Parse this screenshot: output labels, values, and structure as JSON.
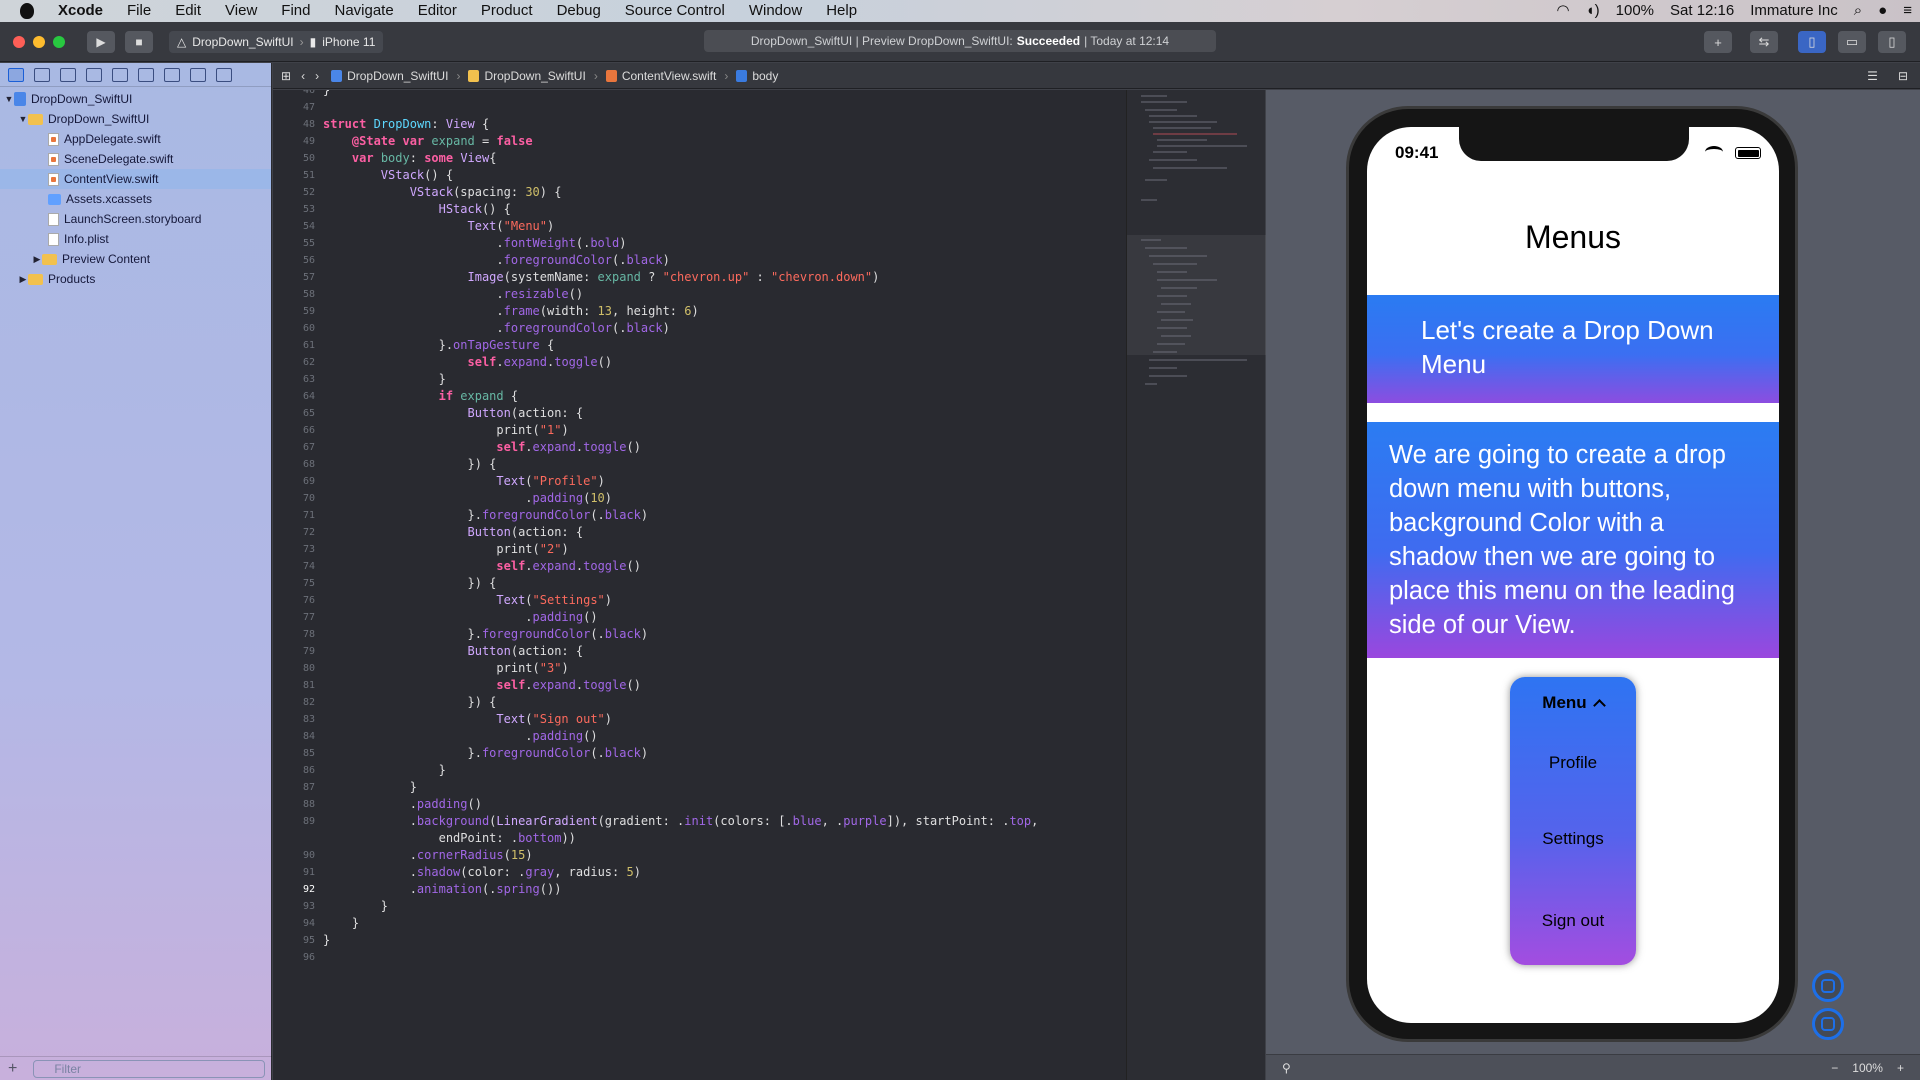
{
  "menubar": {
    "app_name": "Xcode",
    "items": [
      "File",
      "Edit",
      "View",
      "Find",
      "Navigate",
      "Editor",
      "Product",
      "Debug",
      "Source Control",
      "Window",
      "Help"
    ],
    "battery": "100%",
    "clock": "Sat 12:16",
    "user": "Immature Inc"
  },
  "toolbar": {
    "scheme": "DropDown_SwiftUI",
    "device": "iPhone 11",
    "status_prefix": "DropDown_SwiftUI | Preview DropDown_SwiftUI:",
    "status_result": "Succeeded",
    "status_suffix": "| Today at 12:14"
  },
  "navigator": {
    "project": "DropDown_SwiftUI",
    "group": "DropDown_SwiftUI",
    "files": [
      "AppDelegate.swift",
      "SceneDelegate.swift",
      "ContentView.swift",
      "Assets.xcassets",
      "LaunchScreen.storyboard",
      "Info.plist"
    ],
    "preview_content": "Preview Content",
    "products": "Products",
    "filter_placeholder": "Filter"
  },
  "jumpbar": {
    "crumbs": [
      "DropDown_SwiftUI",
      "DropDown_SwiftUI",
      "ContentView.swift",
      "body"
    ]
  },
  "editor": {
    "current_line": 92,
    "lines": [
      {
        "n": "46",
        "code": "}"
      },
      {
        "n": "47",
        "code": ""
      },
      {
        "n": "48",
        "code": "struct DropDown: View {"
      },
      {
        "n": "49",
        "code": "    @State var expand = false"
      },
      {
        "n": "50",
        "code": "    var body: some View{"
      },
      {
        "n": "51",
        "code": "        VStack() {"
      },
      {
        "n": "52",
        "code": "            VStack(spacing: 30) {"
      },
      {
        "n": "53",
        "code": "                HStack() {"
      },
      {
        "n": "54",
        "code": "                    Text(\"Menu\")"
      },
      {
        "n": "55",
        "code": "                        .fontWeight(.bold)"
      },
      {
        "n": "56",
        "code": "                        .foregroundColor(.black)"
      },
      {
        "n": "57",
        "code": "                    Image(systemName: expand ? \"chevron.up\" : \"chevron.down\")"
      },
      {
        "n": "58",
        "code": "                        .resizable()"
      },
      {
        "n": "59",
        "code": "                        .frame(width: 13, height: 6)"
      },
      {
        "n": "60",
        "code": "                        .foregroundColor(.black)"
      },
      {
        "n": "61",
        "code": "                }.onTapGesture {"
      },
      {
        "n": "62",
        "code": "                    self.expand.toggle()"
      },
      {
        "n": "63",
        "code": "                }"
      },
      {
        "n": "64",
        "code": "                if expand {"
      },
      {
        "n": "65",
        "code": "                    Button(action: {"
      },
      {
        "n": "66",
        "code": "                        print(\"1\")"
      },
      {
        "n": "67",
        "code": "                        self.expand.toggle()"
      },
      {
        "n": "68",
        "code": "                    }) {"
      },
      {
        "n": "69",
        "code": "                        Text(\"Profile\")"
      },
      {
        "n": "70",
        "code": "                            .padding(10)"
      },
      {
        "n": "71",
        "code": "                    }.foregroundColor(.black)"
      },
      {
        "n": "72",
        "code": "                    Button(action: {"
      },
      {
        "n": "73",
        "code": "                        print(\"2\")"
      },
      {
        "n": "74",
        "code": "                        self.expand.toggle()"
      },
      {
        "n": "75",
        "code": "                    }) {"
      },
      {
        "n": "76",
        "code": "                        Text(\"Settings\")"
      },
      {
        "n": "77",
        "code": "                            .padding()"
      },
      {
        "n": "78",
        "code": "                    }.foregroundColor(.black)"
      },
      {
        "n": "79",
        "code": "                    Button(action: {"
      },
      {
        "n": "80",
        "code": "                        print(\"3\")"
      },
      {
        "n": "81",
        "code": "                        self.expand.toggle()"
      },
      {
        "n": "82",
        "code": "                    }) {"
      },
      {
        "n": "83",
        "code": "                        Text(\"Sign out\")"
      },
      {
        "n": "84",
        "code": "                            .padding()"
      },
      {
        "n": "85",
        "code": "                    }.foregroundColor(.black)"
      },
      {
        "n": "86",
        "code": "                }"
      },
      {
        "n": "87",
        "code": "            }"
      },
      {
        "n": "88",
        "code": "            .padding()"
      },
      {
        "n": "89",
        "code": "            .background(LinearGradient(gradient: .init(colors: [.blue, .purple]), startPoint: .top,"
      },
      {
        "n": "",
        "code": "                endPoint: .bottom))"
      },
      {
        "n": "90",
        "code": "            .cornerRadius(15)"
      },
      {
        "n": "91",
        "code": "            .shadow(color: .gray, radius: 5)"
      },
      {
        "n": "92",
        "code": "            .animation(.spring())"
      },
      {
        "n": "93",
        "code": "        }"
      },
      {
        "n": "94",
        "code": "    }"
      },
      {
        "n": "95",
        "code": "}"
      },
      {
        "n": "96",
        "code": ""
      }
    ]
  },
  "preview": {
    "time": "09:41",
    "title": "Menus",
    "banner1": "Let's create a Drop Down Menu",
    "banner2": "We are going to create a drop down menu with buttons, background Color with a shadow then we are going to place this menu on the leading side of our View.",
    "menu_label": "Menu",
    "menu_items": [
      "Profile",
      "Settings",
      "Sign out"
    ],
    "zoom": "100%"
  }
}
